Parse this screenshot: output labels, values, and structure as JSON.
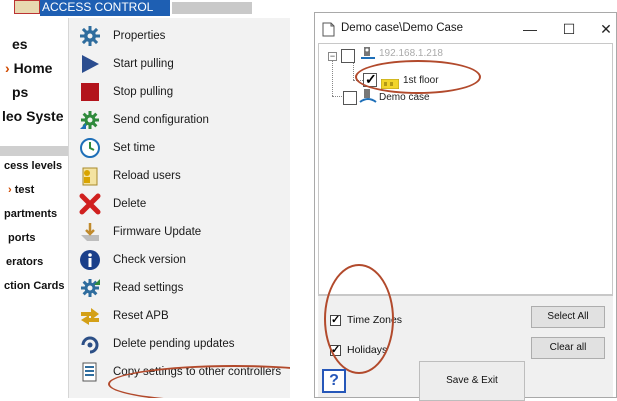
{
  "left_app": {
    "title_fragment": "ACCESS CONTROL",
    "tree": {
      "items": [
        {
          "label": "es",
          "size": "big"
        },
        {
          "label": "Home",
          "size": "big",
          "prefix": "›"
        },
        {
          "label": "ps",
          "size": "big"
        },
        {
          "label": "leo Syste",
          "size": "big"
        },
        {
          "label": "cess levels",
          "size": "small"
        },
        {
          "label": "test",
          "size": "small",
          "prefix": "›"
        },
        {
          "label": "partments",
          "size": "small"
        },
        {
          "label": "ports",
          "size": "small"
        },
        {
          "label": "erators",
          "size": "small"
        },
        {
          "label": "ction Cards",
          "size": "small"
        }
      ]
    },
    "context_menu": {
      "items": [
        {
          "label": "Properties",
          "icon": "gear-icon",
          "color": "#2f6d9e"
        },
        {
          "label": "Start pulling",
          "icon": "play-icon",
          "color": "#2b4d8f"
        },
        {
          "label": "Stop pulling",
          "icon": "stop-icon",
          "color": "#b3141c"
        },
        {
          "label": "Send configuration",
          "icon": "send-gear-icon",
          "color": "#2f8a3c"
        },
        {
          "label": "Set time",
          "icon": "clock-icon",
          "color": "#1e6fb8"
        },
        {
          "label": "Reload users",
          "icon": "users-icon",
          "color": "#d9a400"
        },
        {
          "label": "Delete",
          "icon": "delete-x-icon",
          "color": "#d0201f"
        },
        {
          "label": "Firmware Update",
          "icon": "firmware-icon",
          "color": "#c08a2c"
        },
        {
          "label": "Check version",
          "icon": "info-icon",
          "color": "#1a3f8a"
        },
        {
          "label": "Read settings",
          "icon": "read-gear-icon",
          "color": "#2f6d9e"
        },
        {
          "label": "Reset APB",
          "icon": "reset-apb-icon",
          "color": "#d4a017"
        },
        {
          "label": "Delete pending updates",
          "icon": "pending-icon",
          "color": "#2c4f86"
        },
        {
          "label": "Copy settings to other controllers",
          "icon": "copy-settings-icon",
          "color": "#2f6d9e"
        }
      ]
    }
  },
  "dialog": {
    "title": "Demo case\\Demo Case",
    "controls": {
      "minimize": "—",
      "maximize": "☐",
      "close": "✕"
    },
    "tree": {
      "root": {
        "label": "192.168.1.218",
        "checked": false
      },
      "child": {
        "label": "1st floor",
        "checked": true
      },
      "sibling": {
        "label": "Demo case",
        "checked": false
      }
    },
    "options": [
      {
        "label": "Time Zones",
        "checked": true
      },
      {
        "label": "Holidays",
        "checked": true
      }
    ],
    "buttons": {
      "select_all": "Select All",
      "clear_all": "Clear all",
      "save_exit": "Save & Exit",
      "help": "?"
    },
    "annotation_color": "#b24a2c"
  }
}
